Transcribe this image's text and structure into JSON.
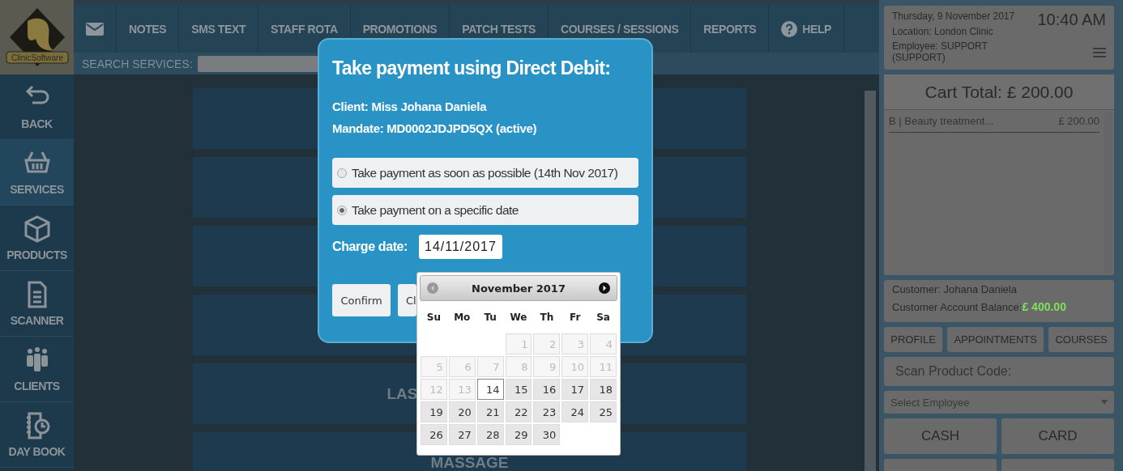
{
  "logo": {
    "text": "ClinicSoftware"
  },
  "nav": [
    {
      "kind": "mail"
    },
    {
      "kind": "text",
      "label": "NOTES"
    },
    {
      "kind": "text",
      "label": "SMS TEXT"
    },
    {
      "kind": "text",
      "label": "STAFF ROTA"
    },
    {
      "kind": "text",
      "label": "PROMOTIONS"
    },
    {
      "kind": "text",
      "label": "PATCH TESTS"
    },
    {
      "kind": "text",
      "label": "COURSES / SESSIONS"
    },
    {
      "kind": "text",
      "label": "REPORTS"
    },
    {
      "kind": "help",
      "label": "HELP"
    }
  ],
  "search": {
    "label": "SEARCH SERVICES:"
  },
  "sidebar": [
    {
      "kind": "back",
      "label": "BACK",
      "selected": false
    },
    {
      "kind": "basket",
      "label": "SERVICES",
      "selected": true
    },
    {
      "kind": "box",
      "label": "PRODUCTS",
      "selected": false
    },
    {
      "kind": "document",
      "label": "SCANNER",
      "selected": false
    },
    {
      "kind": "people",
      "label": "CLIENTS",
      "selected": false
    },
    {
      "kind": "calendar",
      "label": "DAY BOOK",
      "selected": false
    }
  ],
  "tiles": [
    {
      "kind": "blank"
    },
    {
      "kind": "blank"
    },
    {
      "kind": "blank"
    },
    {
      "kind": "blank"
    },
    {
      "kind": "label",
      "label": "LAS",
      "cut": true
    },
    {
      "kind": "label",
      "label": "MASSAGE",
      "cut": false
    }
  ],
  "header": {
    "date": "Thursday, 9 November 2017",
    "time": "10:40 AM",
    "location": "Location: London Clinic",
    "employee": "Employee: SUPPORT (SUPPORT)"
  },
  "cart": {
    "total": "Cart Total:  £ 200.00",
    "items": [
      {
        "name": "B | Beauty treatment...",
        "price": "£ 200.00"
      }
    ]
  },
  "customer": {
    "name": "Customer: Johana Daniela",
    "balance_label": "Customer Account Balance:",
    "balance": "£ 400.00"
  },
  "customer_buttons": [
    "PROFILE",
    "APPOINTMENTS",
    "COURSES"
  ],
  "scan": {
    "placeholder": "Scan Product Code:"
  },
  "employee_select": {
    "placeholder": "Select Employee"
  },
  "pay_buttons": [
    "CASH",
    "CARD"
  ],
  "modal": {
    "title": "Take payment using Direct Debit:",
    "client": "Client: Miss Johana Daniela",
    "mandate": "Mandate: MD0002JDJPD5QX (active)",
    "options": [
      {
        "label": "Take payment as soon as possible (14th Nov 2017)",
        "selected": false
      },
      {
        "label": "Take payment on a specific date",
        "selected": true
      }
    ],
    "charge_label": "Charge date:",
    "charge_value": "14/11/2017",
    "buttons": [
      "Confirm",
      "Cl"
    ]
  },
  "datepicker": {
    "month": "November 2017",
    "prev_disabled": true,
    "weekdays": [
      "Su",
      "Mo",
      "Tu",
      "We",
      "Th",
      "Fr",
      "Sa"
    ],
    "weeks": [
      [
        {
          "kind": "blank"
        },
        {
          "kind": "blank"
        },
        {
          "kind": "blank"
        },
        {
          "day": "1",
          "disabled": true,
          "selected": false
        },
        {
          "day": "2",
          "disabled": true,
          "selected": false
        },
        {
          "day": "3",
          "disabled": true,
          "selected": false
        },
        {
          "day": "4",
          "disabled": true,
          "selected": false
        }
      ],
      [
        {
          "day": "5",
          "disabled": true,
          "selected": false
        },
        {
          "day": "6",
          "disabled": true,
          "selected": false
        },
        {
          "day": "7",
          "disabled": true,
          "selected": false
        },
        {
          "day": "8",
          "disabled": true,
          "selected": false
        },
        {
          "day": "9",
          "disabled": true,
          "selected": false
        },
        {
          "day": "10",
          "disabled": true,
          "selected": false
        },
        {
          "day": "11",
          "disabled": true,
          "selected": false
        }
      ],
      [
        {
          "day": "12",
          "disabled": true,
          "selected": false
        },
        {
          "day": "13",
          "disabled": true,
          "selected": false
        },
        {
          "day": "14",
          "disabled": false,
          "selected": true
        },
        {
          "day": "15",
          "disabled": false,
          "selected": false
        },
        {
          "day": "16",
          "disabled": false,
          "selected": false
        },
        {
          "day": "17",
          "disabled": false,
          "selected": false
        },
        {
          "day": "18",
          "disabled": false,
          "selected": false
        }
      ],
      [
        {
          "day": "19",
          "disabled": false,
          "selected": false
        },
        {
          "day": "20",
          "disabled": false,
          "selected": false
        },
        {
          "day": "21",
          "disabled": false,
          "selected": false
        },
        {
          "day": "22",
          "disabled": false,
          "selected": false
        },
        {
          "day": "23",
          "disabled": false,
          "selected": false
        },
        {
          "day": "24",
          "disabled": false,
          "selected": false
        },
        {
          "day": "25",
          "disabled": false,
          "selected": false
        }
      ],
      [
        {
          "day": "26",
          "disabled": false,
          "selected": false
        },
        {
          "day": "27",
          "disabled": false,
          "selected": false
        },
        {
          "day": "28",
          "disabled": false,
          "selected": false
        },
        {
          "day": "29",
          "disabled": false,
          "selected": false
        },
        {
          "day": "30",
          "disabled": false,
          "selected": false
        }
      ]
    ]
  }
}
